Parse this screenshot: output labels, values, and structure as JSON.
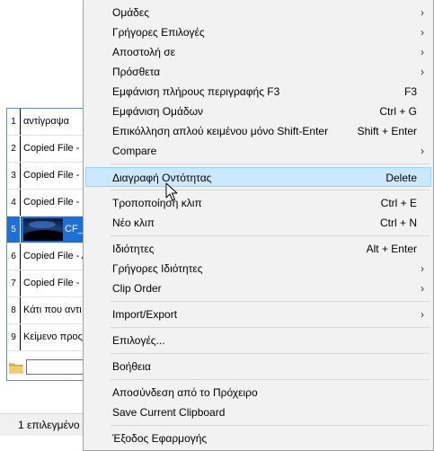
{
  "clips": [
    {
      "num": "1",
      "text": "αντίγραψα"
    },
    {
      "num": "2",
      "text": "Copied File - C"
    },
    {
      "num": "3",
      "text": "Copied File - C"
    },
    {
      "num": "4",
      "text": "Copied File - C"
    },
    {
      "num": "5",
      "text": "CF_",
      "selected": true
    },
    {
      "num": "6",
      "text": "Copied File - A"
    },
    {
      "num": "7",
      "text": "Copied File - C"
    },
    {
      "num": "8",
      "text": "Κάτι που αντι"
    },
    {
      "num": "9",
      "text": "Κείμενο προς"
    }
  ],
  "status": {
    "text": "1 επιλεγμένο"
  },
  "search": {
    "value": ""
  },
  "menu": {
    "items": [
      {
        "label": "Ομάδες",
        "shortcut": "",
        "submenu": true
      },
      {
        "label": "Γρήγορες Επιλογές",
        "shortcut": "",
        "submenu": true
      },
      {
        "label": "Αποστολή σε",
        "shortcut": "",
        "submenu": true
      },
      {
        "label": "Πρόσθετα",
        "shortcut": "",
        "submenu": true
      },
      {
        "label": "Εμφάνιση πλήρους περιγραφής F3",
        "shortcut": "F3",
        "submenu": false
      },
      {
        "label": "Εμφάνιση Ομάδων",
        "shortcut": "Ctrl + G",
        "submenu": false
      },
      {
        "label": "Επικόλληση απλού κειμένου μόνο Shift-Enter",
        "shortcut": "Shift + Enter",
        "submenu": false
      },
      {
        "label": "Compare",
        "shortcut": "",
        "submenu": true
      },
      {
        "label": "Διαγραφή Οντότητας",
        "shortcut": "Delete",
        "submenu": false,
        "highlighted": true
      },
      {
        "label": "Τροποποίηση κλιπ",
        "shortcut": "Ctrl + E",
        "submenu": false
      },
      {
        "label": "Νέο κλιπ",
        "shortcut": "Ctrl + N",
        "submenu": false
      },
      {
        "label": "Ιδιότητες",
        "shortcut": "Alt + Enter",
        "submenu": false
      },
      {
        "label": "Γρήγορες Ιδιότητες",
        "shortcut": "",
        "submenu": true
      },
      {
        "label": "Clip Order",
        "shortcut": "",
        "submenu": true
      },
      {
        "label": "Import/Export",
        "shortcut": "",
        "submenu": true
      },
      {
        "label": "Επιλογές...",
        "shortcut": "",
        "submenu": false
      },
      {
        "label": "Βοήθεια",
        "shortcut": "",
        "submenu": false
      },
      {
        "label": "Αποσύνδεση από το Πρόχειρο",
        "shortcut": "",
        "submenu": false
      },
      {
        "label": "Save Current Clipboard",
        "shortcut": "",
        "submenu": false
      },
      {
        "label": "Έξοδος Εφαρμογής",
        "shortcut": "",
        "submenu": false
      }
    ],
    "arrow_glyph": "›"
  },
  "colors": {
    "highlight": "#cce8ff",
    "selection": "#1e6fd6",
    "menu_bg": "#f2f2f2"
  }
}
